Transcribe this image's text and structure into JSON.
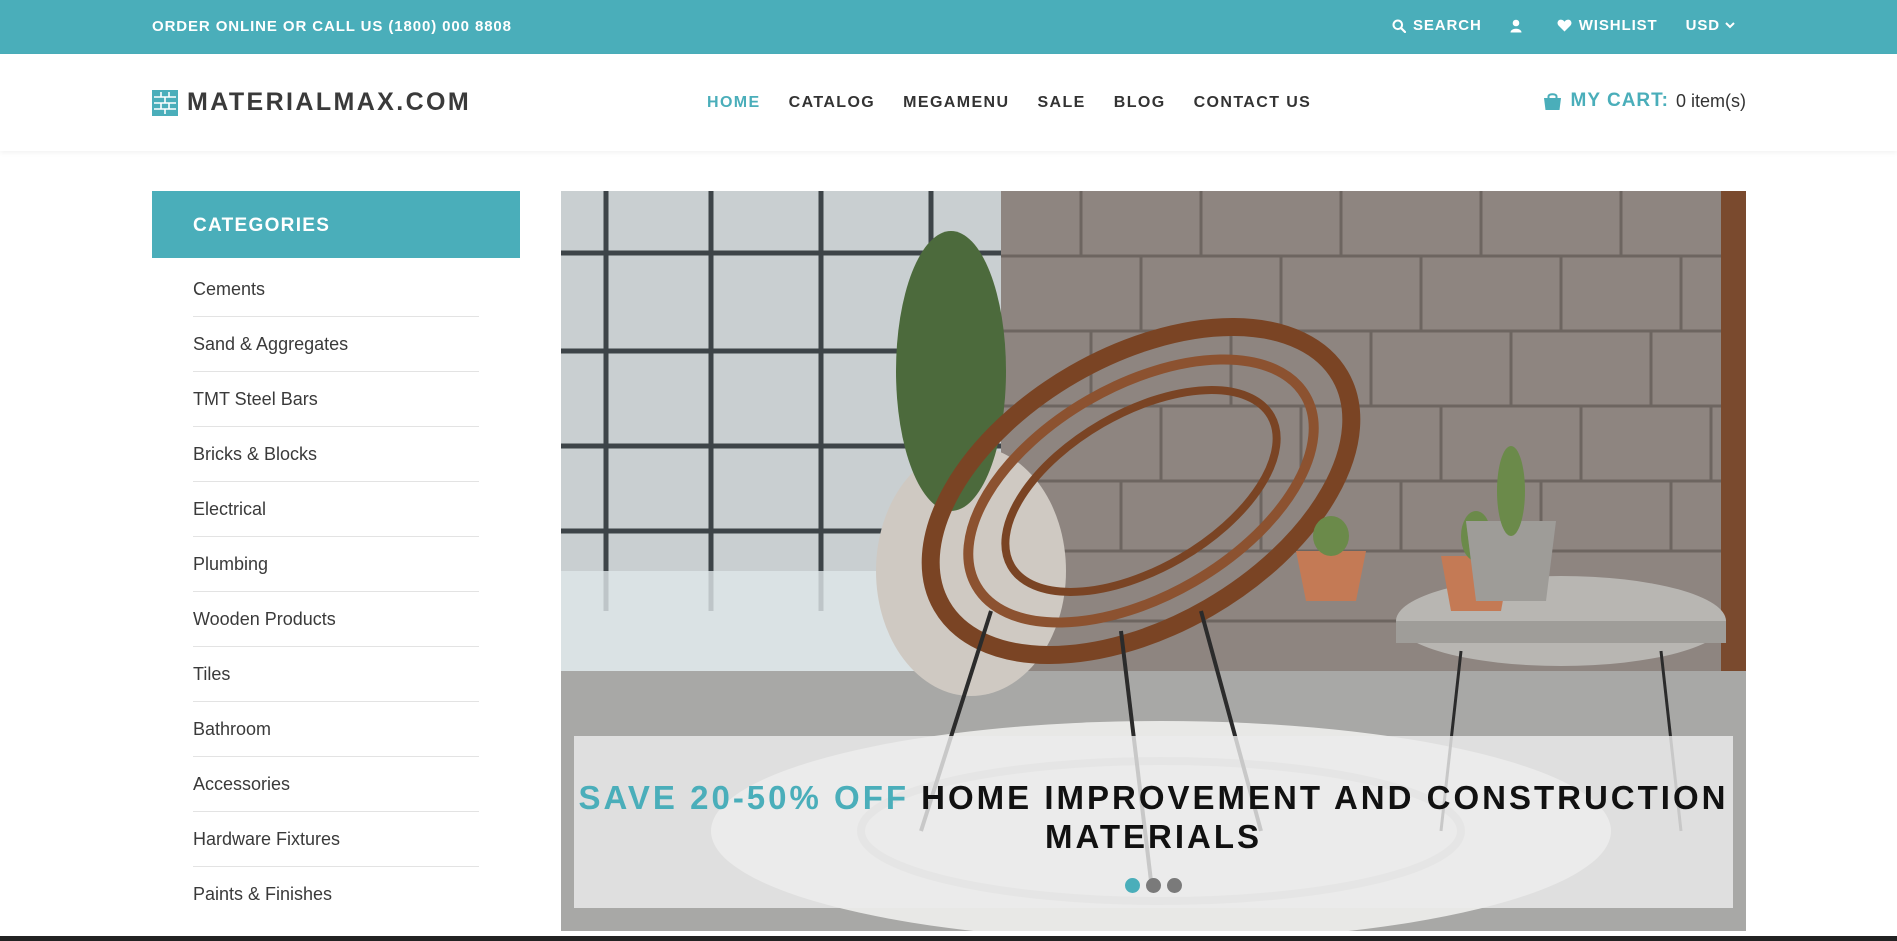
{
  "colors": {
    "accent": "#4aaeba",
    "text": "#333333"
  },
  "topbar": {
    "promo": "ORDER ONLINE OR CALL US (1800) 000 8808",
    "search_label": "SEARCH",
    "search_icon": "search-icon",
    "account_icon": "user-icon",
    "wishlist_label": "WISHLIST",
    "wishlist_icon": "heart-icon",
    "currency": "USD",
    "currency_icon": "chevron-down-icon"
  },
  "header": {
    "logo_text": "MATERIALMAX.COM",
    "logo_icon": "brick-wall-icon",
    "nav": [
      {
        "label": "HOME",
        "active": true
      },
      {
        "label": "CATALOG"
      },
      {
        "label": "MEGAMENU"
      },
      {
        "label": "SALE"
      },
      {
        "label": "BLOG"
      },
      {
        "label": "CONTACT US"
      }
    ],
    "cart": {
      "icon": "shopping-bag-icon",
      "label": "MY CART:",
      "count": "0 item(s)"
    }
  },
  "sidebar": {
    "title": "CATEGORIES",
    "items": [
      "Cements",
      "Sand & Aggregates",
      "TMT Steel Bars",
      "Bricks & Blocks",
      "Electrical",
      "Plumbing",
      "Wooden Products",
      "Tiles",
      "Bathroom",
      "Accessories",
      "Hardware Fixtures",
      "Paints & Finishes"
    ]
  },
  "hero": {
    "headline_accent": "SAVE 20-50% OFF",
    "headline_rest": " HOME IMPROVEMENT AND CONSTRUCTION MATERIALS",
    "slide_count": 3,
    "active_slide": 1
  }
}
